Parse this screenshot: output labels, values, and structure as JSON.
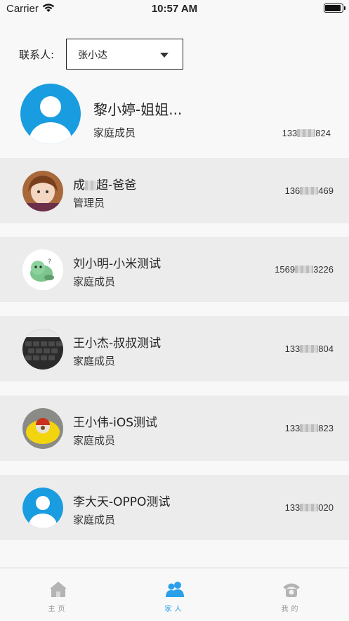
{
  "status_bar": {
    "carrier": "Carrier",
    "time": "10:57 AM"
  },
  "contact": {
    "label": "联系人:",
    "selected": "张小达"
  },
  "owner": {
    "name": "黎小婷-姐姐...",
    "role": "家庭成员",
    "phone_prefix": "133",
    "phone_suffix": "824"
  },
  "members": [
    {
      "name_a": "成",
      "name_b": "超-爸爸",
      "role": "管理员",
      "phone_prefix": "136",
      "phone_suffix": "469",
      "avatar": "anime-avatar"
    },
    {
      "name_a": "刘小明-小米测试",
      "name_b": "",
      "role": "家庭成员",
      "phone_prefix": "1569",
      "phone_suffix": "3226",
      "avatar": "green-monster-avatar"
    },
    {
      "name_a": "王小杰-叔叔测试",
      "name_b": "",
      "role": "家庭成员",
      "phone_prefix": "133",
      "phone_suffix": "804",
      "avatar": "keyboard-photo-avatar"
    },
    {
      "name_a": "王小伟-iOS测试",
      "name_b": "",
      "role": "家庭成员",
      "phone_prefix": "133",
      "phone_suffix": "823",
      "avatar": "toy-photo-avatar"
    },
    {
      "name_a": "李大天-OPPO测试",
      "name_b": "",
      "role": "家庭成员",
      "phone_prefix": "133",
      "phone_suffix": "020",
      "avatar": "default-user-avatar"
    }
  ],
  "tabs": [
    {
      "label": "主页",
      "icon": "home-icon",
      "active": false
    },
    {
      "label": "家人",
      "icon": "family-icon",
      "active": true
    },
    {
      "label": "我的",
      "icon": "profile-phone-icon",
      "active": false
    }
  ],
  "colors": {
    "accent": "#2aa0ea",
    "avatar_blue": "#1a9ce0",
    "row_bg": "#ececec",
    "inactive_tab": "#9a9a9a"
  }
}
